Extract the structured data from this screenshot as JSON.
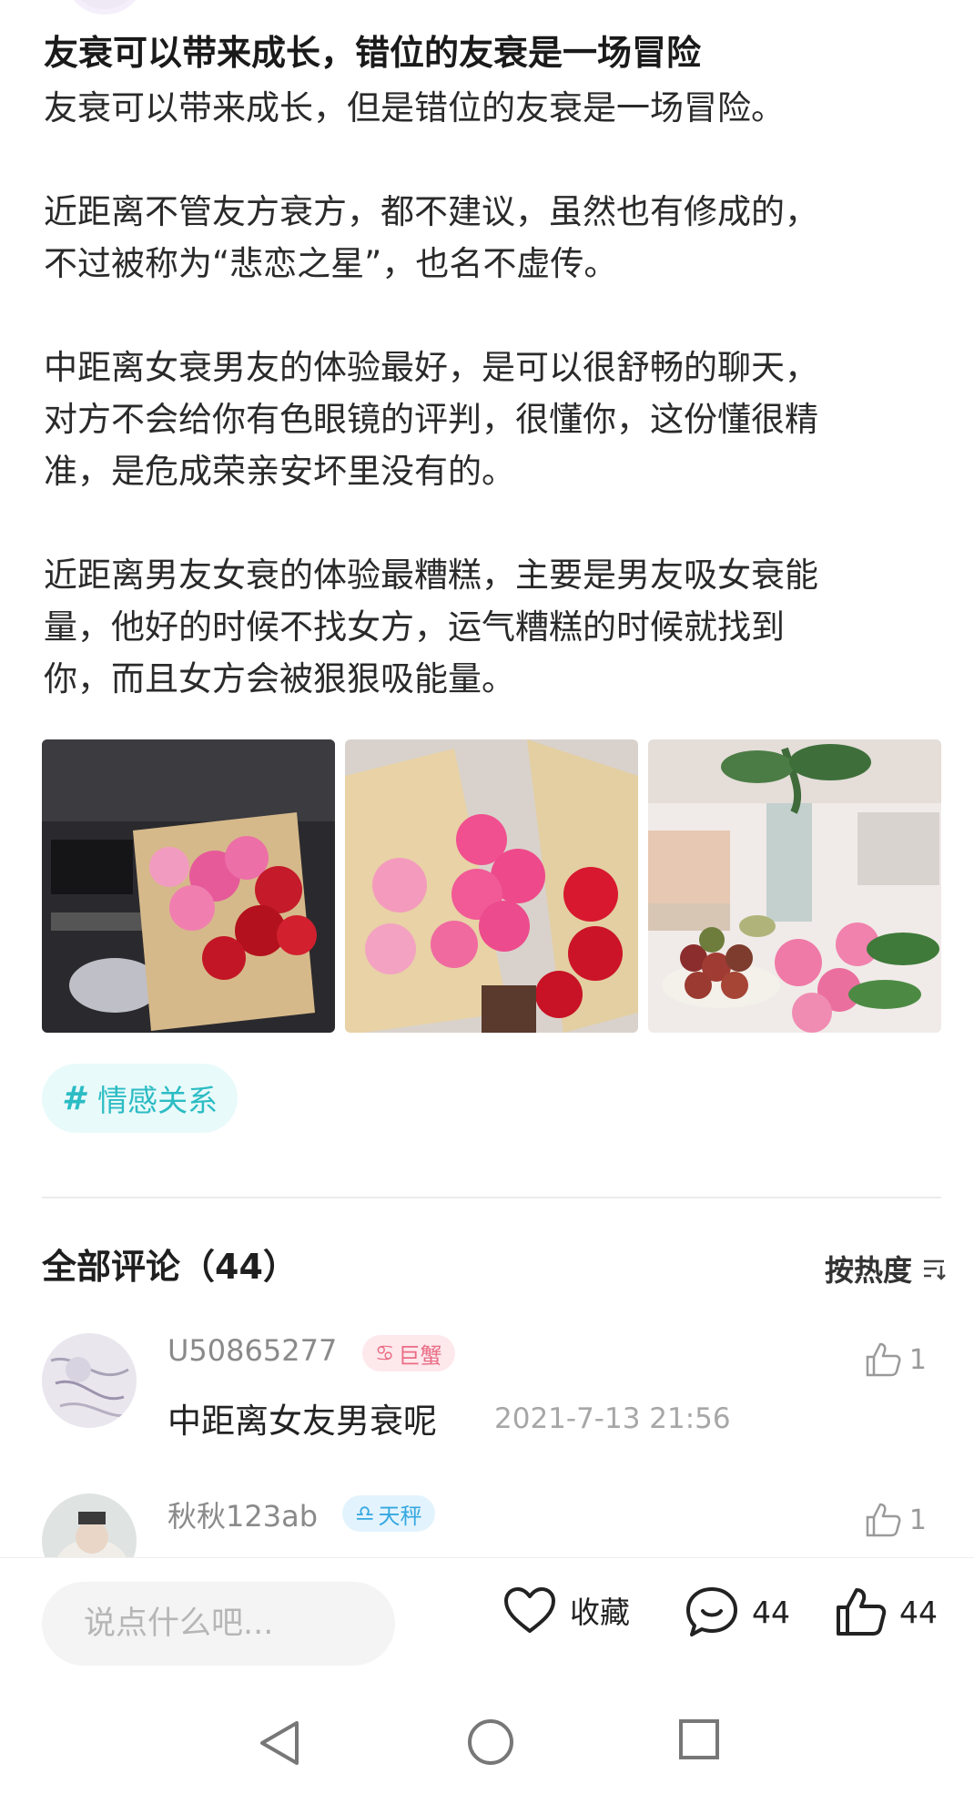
{
  "post": {
    "title": "友衰可以带来成长，错位的友衰是一场冒险",
    "paragraphs": [
      [
        "友衰可以带来成长，但是错位的友衰是一场冒险。"
      ],
      [
        "近距离不管友方衰方，都不建议，虽然也有修成的，",
        "不过被称为“悲恋之星”，也名不虚传。"
      ],
      [
        "中距离女衰男友的体验最好，是可以很舒畅的聊天，",
        "对方不会给你有色眼镜的评判，很懂你，这份懂很精",
        "准，是危成荣亲安坏里没有的。"
      ],
      [
        "近距离男友女衰的体验最糟糕，主要是男友吸女衰能",
        "量，他好的时候不找女方，运气糟糕的时候就找到",
        "你，而且女方会被狠狠吸能量。"
      ]
    ],
    "topic_tag": {
      "icon": "hash-icon",
      "label": "情感关系"
    }
  },
  "comments_section": {
    "title": "全部评论（44）",
    "sort_label": "按热度",
    "comments": [
      {
        "username": "U50865277",
        "zodiac": "巨蟹",
        "text": "中距离女友男衰呢",
        "time": "2021-7-13 21:56",
        "likes": "1"
      },
      {
        "username": "秋秋123ab",
        "zodiac": "天秤",
        "text": "",
        "time": "",
        "likes": "1"
      }
    ]
  },
  "bottom_bar": {
    "input_placeholder": "说点什么吧...",
    "favorite_label": "收藏",
    "comment_count": "44",
    "like_count": "44"
  },
  "colors": {
    "accent_teal": "#2cbcc4",
    "tag_bg": "#e9fafa",
    "cancer_badge": "#ea6d85",
    "libra_badge": "#35a8e0"
  }
}
